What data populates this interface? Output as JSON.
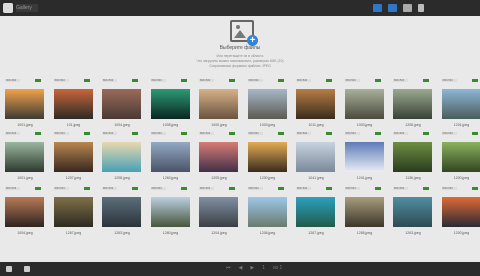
{
  "app": {
    "title": "Gallery"
  },
  "toolbar": {
    "icons": [
      "grid-icon",
      "folder-icon",
      "share-icon",
      "trash-icon"
    ]
  },
  "upload": {
    "title": "Выберите файлы",
    "line1": "Или перетащите их в область",
    "line2": "Что загрузить можно максимально, размером 4МБ (10)",
    "line3": "Сохраняемые форматы файлов: JPEG"
  },
  "rows": [
    {
      "items": [
        {
          "label": "1001.jpeg",
          "dim": "900×600",
          "colors": [
            "#f2a24a",
            "#3d3b35"
          ]
        },
        {
          "label": "101.jpeg",
          "dim": "800×533",
          "colors": [
            "#c9663a",
            "#2d2a26"
          ]
        },
        {
          "label": "1004.jpeg",
          "dim": "800×533",
          "colors": [
            "#9a6b5a",
            "#4a3a34"
          ]
        },
        {
          "label": "1008.jpeg",
          "dim": "800×533",
          "colors": [
            "#2c9b75",
            "#0b2520"
          ]
        },
        {
          "label": "1000.jpeg",
          "dim": "800×533",
          "colors": [
            "#d7b287",
            "#6a5340"
          ]
        },
        {
          "label": "1003.jpeg",
          "dim": "800×533",
          "colors": [
            "#a7b7c7",
            "#5c5a52"
          ]
        },
        {
          "label": "1011.jpeg",
          "dim": "800×533",
          "colors": [
            "#b77d45",
            "#3a2b1e"
          ]
        },
        {
          "label": "1003.jpeg",
          "dim": "800×533",
          "colors": [
            "#a8b09a",
            "#4c4b3d"
          ]
        },
        {
          "label": "1206.jpeg",
          "dim": "800×533",
          "colors": [
            "#9aaa8f",
            "#394236"
          ]
        },
        {
          "label": "1201.jpeg",
          "dim": "800×533",
          "colors": [
            "#8db6d7",
            "#4a5c5c"
          ]
        }
      ]
    },
    {
      "items": [
        {
          "label": "1001.jpeg",
          "dim": "800×533",
          "colors": [
            "#9ab7a0",
            "#2d3a2e"
          ]
        },
        {
          "label": "1207.jpeg",
          "dim": "800×533",
          "colors": [
            "#b9874e",
            "#382720"
          ]
        },
        {
          "label": "1208.jpeg",
          "dim": "800×533",
          "colors": [
            "#e8d8b0",
            "#49a0b5"
          ]
        },
        {
          "label": "1263.jpeg",
          "dim": "800×533",
          "colors": [
            "#93a9c4",
            "#4a5366"
          ]
        },
        {
          "label": "1205.jpeg",
          "dim": "800×533",
          "colors": [
            "#d87c75",
            "#423049"
          ]
        },
        {
          "label": "1200.jpeg",
          "dim": "800×533",
          "colors": [
            "#e4ad54",
            "#3a2b1e"
          ]
        },
        {
          "label": "1041.jpeg",
          "dim": "800×533",
          "colors": [
            "#c7d3e0",
            "#7a8898"
          ]
        },
        {
          "label": "1241.jpeg",
          "dim": "800×533",
          "colors": [
            "#5d7bb8",
            "#eaeef4"
          ]
        },
        {
          "label": "1136.jpeg",
          "dim": "800×533",
          "colors": [
            "#6c8f42",
            "#2a3b1e"
          ]
        },
        {
          "label": "1200.jpeg",
          "dim": "800×533",
          "colors": [
            "#8bb35c",
            "#304522"
          ]
        }
      ]
    },
    {
      "items": [
        {
          "label": "1004.jpeg",
          "dim": "800×533",
          "colors": [
            "#b97955",
            "#2e2421"
          ]
        },
        {
          "label": "1267.jpeg",
          "dim": "800×533",
          "colors": [
            "#7f7049",
            "#2c2a20"
          ]
        },
        {
          "label": "1263.jpeg",
          "dim": "800×533",
          "colors": [
            "#5c6f7a",
            "#2b333a"
          ]
        },
        {
          "label": "1260.jpeg",
          "dim": "800×533",
          "colors": [
            "#bccfe0",
            "#46563c"
          ]
        },
        {
          "label": "1204.jpeg",
          "dim": "800×533",
          "colors": [
            "#7f90a2",
            "#3b3f44"
          ]
        },
        {
          "label": "1206.jpeg",
          "dim": "800×533",
          "colors": [
            "#9dc7e8",
            "#6a7a6e"
          ]
        },
        {
          "label": "1267.jpeg",
          "dim": "800×533",
          "colors": [
            "#2ca0c0",
            "#215b4a"
          ]
        },
        {
          "label": "1265.jpeg",
          "dim": "800×533",
          "colors": [
            "#a79c7d",
            "#3d362a"
          ]
        },
        {
          "label": "1263.jpeg",
          "dim": "800×533",
          "colors": [
            "#4e8fa2",
            "#2f4a52"
          ]
        },
        {
          "label": "1200.jpeg",
          "dim": "800×533",
          "colors": [
            "#e06a35",
            "#2b2a35"
          ]
        }
      ]
    }
  ],
  "pager": {
    "current": "1",
    "of": "из 1"
  }
}
